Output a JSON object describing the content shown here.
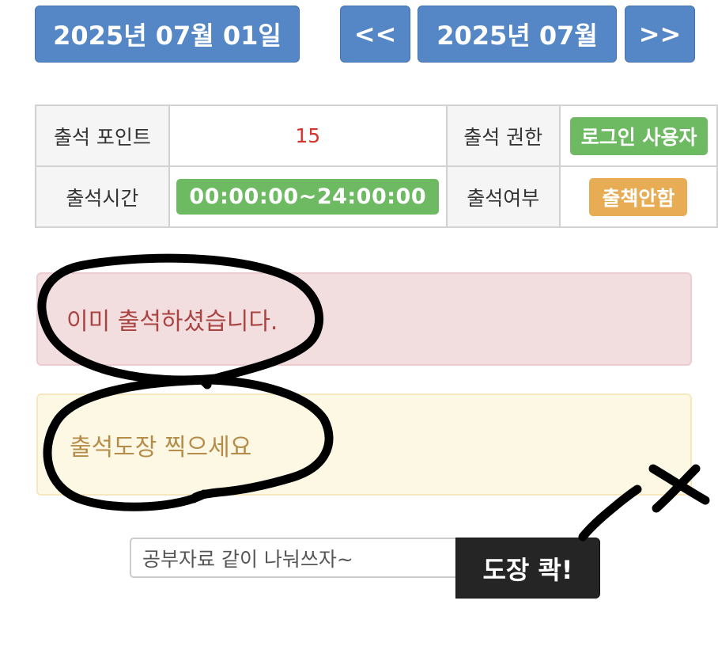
{
  "header": {
    "date_label": "2025년 07월 01일",
    "prev_label": "<<",
    "month_label": "2025년 07월",
    "next_label": ">>"
  },
  "info_table": {
    "point_label": "출석 포인트",
    "point_value": "15",
    "permission_label": "출석 권한",
    "permission_value": "로그인 사용자",
    "time_label": "출석시간",
    "time_value": "00:00:00~24:00:00",
    "status_label": "출석여부",
    "status_value": "출책안함"
  },
  "alerts": {
    "danger": "이미 출석하셨습니다.",
    "warning": "출석도장 찍으세요"
  },
  "form": {
    "memo_value": "공부자료 같이 나눠쓰자~",
    "stamp_button_label": "도장 콱!"
  },
  "colors": {
    "primary_button": "#5587c7",
    "success_badge": "#6dba63",
    "warning_badge": "#e8ac55",
    "danger_alert_bg": "#f2dedf",
    "danger_alert_text": "#a94442",
    "warning_alert_bg": "#fcf8e3",
    "warning_alert_text": "#b58c4a",
    "point_text": "#d9342b",
    "dark_button": "#252525",
    "annotation_ink": "#000000"
  }
}
